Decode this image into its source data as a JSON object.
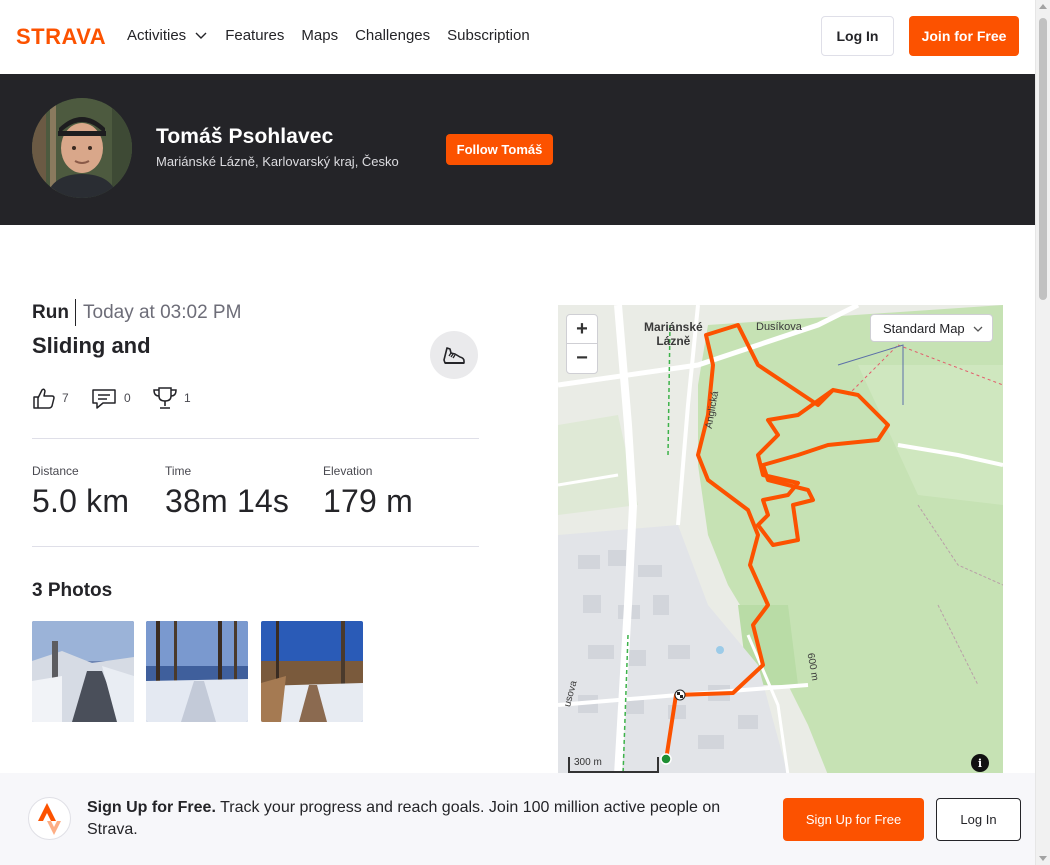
{
  "nav": {
    "logo_text": "STRAVA",
    "links": [
      {
        "label": "Activities",
        "dropdown": true
      },
      {
        "label": "Features"
      },
      {
        "label": "Maps"
      },
      {
        "label": "Challenges"
      },
      {
        "label": "Subscription"
      }
    ],
    "login_label": "Log In",
    "join_label": "Join for Free"
  },
  "athlete": {
    "name": "Tomáš Psohlavec",
    "location": "Mariánské Lázně, Karlovarský kraj, Česko",
    "follow_label": "Follow Tomáš"
  },
  "activity": {
    "type": "Run",
    "time": "Today at 03:02 PM",
    "title": "Sliding and",
    "sport_icon": "running-shoe-icon",
    "kudos_count": "7",
    "comments_count": "0",
    "achievements_count": "1",
    "stats": [
      {
        "label": "Distance",
        "value": "5.0 km"
      },
      {
        "label": "Time",
        "value": "38m 14s"
      },
      {
        "label": "Elevation",
        "value": "179 m"
      }
    ],
    "photos_title": "3 Photos"
  },
  "map": {
    "style_label": "Standard Map",
    "zoom_in": "+",
    "zoom_out": "−",
    "scale_label": "300 m",
    "info_label": "i",
    "place_label": "Mariánské Lázně",
    "street_labels": [
      "Dusíkova",
      "Anglická",
      "usova",
      "600 m"
    ]
  },
  "banner": {
    "headline": "Sign Up for Free.",
    "text": "Track your progress and reach goals. Join 100 million active people on Strava.",
    "signup_label": "Sign Up for Free",
    "login_label": "Log In"
  },
  "colors": {
    "brand": "#fc5200",
    "header_bg": "#242428",
    "route": "#fc5200"
  }
}
